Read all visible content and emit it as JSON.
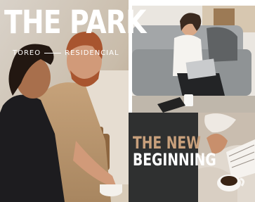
{
  "brand": {
    "name": "THE PARK",
    "location": "TOREO",
    "descriptor": "RESIDENCIAL"
  },
  "tagline": {
    "line1": "THE NEW",
    "line2": "BEGINNING"
  },
  "photos": {
    "hero": "couple-embracing-photo",
    "top_right": "woman-laptop-sofa-photo",
    "bottom_right": "coffee-book-bed-photo"
  },
  "colors": {
    "dark_panel": "#2f3030",
    "accent_gold": "#c8a07c",
    "text_white": "#ffffff"
  }
}
